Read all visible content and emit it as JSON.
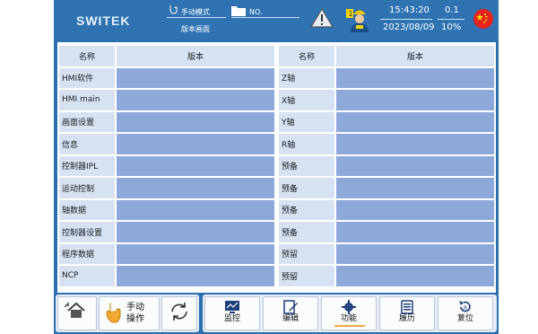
{
  "header": {
    "logo": "SWITEK",
    "mode_label": "手动模式",
    "page_label": "版本画面",
    "no_label": "NO.",
    "time": "15:43:20",
    "date": "2023/08/09",
    "version": "0.1",
    "percent": "10%",
    "worker_badge": "1"
  },
  "left_table": {
    "headers": [
      "名称",
      "版本"
    ],
    "rows": [
      {
        "name": "HMI软件",
        "value": ""
      },
      {
        "name": "HMI main",
        "value": ""
      },
      {
        "name": "画面设置",
        "value": ""
      },
      {
        "name": "信息",
        "value": ""
      },
      {
        "name": "控制器IPL",
        "value": ""
      },
      {
        "name": "运动控制",
        "value": ""
      },
      {
        "name": "轴数据",
        "value": ""
      },
      {
        "name": "控制器设置",
        "value": ""
      },
      {
        "name": "程序数据",
        "value": ""
      },
      {
        "name": "NCP",
        "value": ""
      }
    ]
  },
  "right_table": {
    "headers": [
      "名称",
      "版本"
    ],
    "rows": [
      {
        "name": "Z轴",
        "value": ""
      },
      {
        "name": "X轴",
        "value": ""
      },
      {
        "name": "Y轴",
        "value": ""
      },
      {
        "name": "R轴",
        "value": ""
      },
      {
        "name": "预备",
        "value": ""
      },
      {
        "name": "预备",
        "value": ""
      },
      {
        "name": "预备",
        "value": ""
      },
      {
        "name": "预备",
        "value": ""
      },
      {
        "name": "预留",
        "value": ""
      },
      {
        "name": "预留",
        "value": ""
      }
    ]
  },
  "bottom": {
    "manual_op_line1": "手动",
    "manual_op_line2": "操作",
    "monitor": "监控",
    "edit": "编辑",
    "function": "功能",
    "history": "履历",
    "reset": "复位"
  },
  "colors": {
    "frame": "#2a6fae",
    "header_cell": "#d6e1f2",
    "value_cell": "#8fa8da",
    "active_underline": "#f2a93b",
    "flag_red": "#e5231f"
  }
}
